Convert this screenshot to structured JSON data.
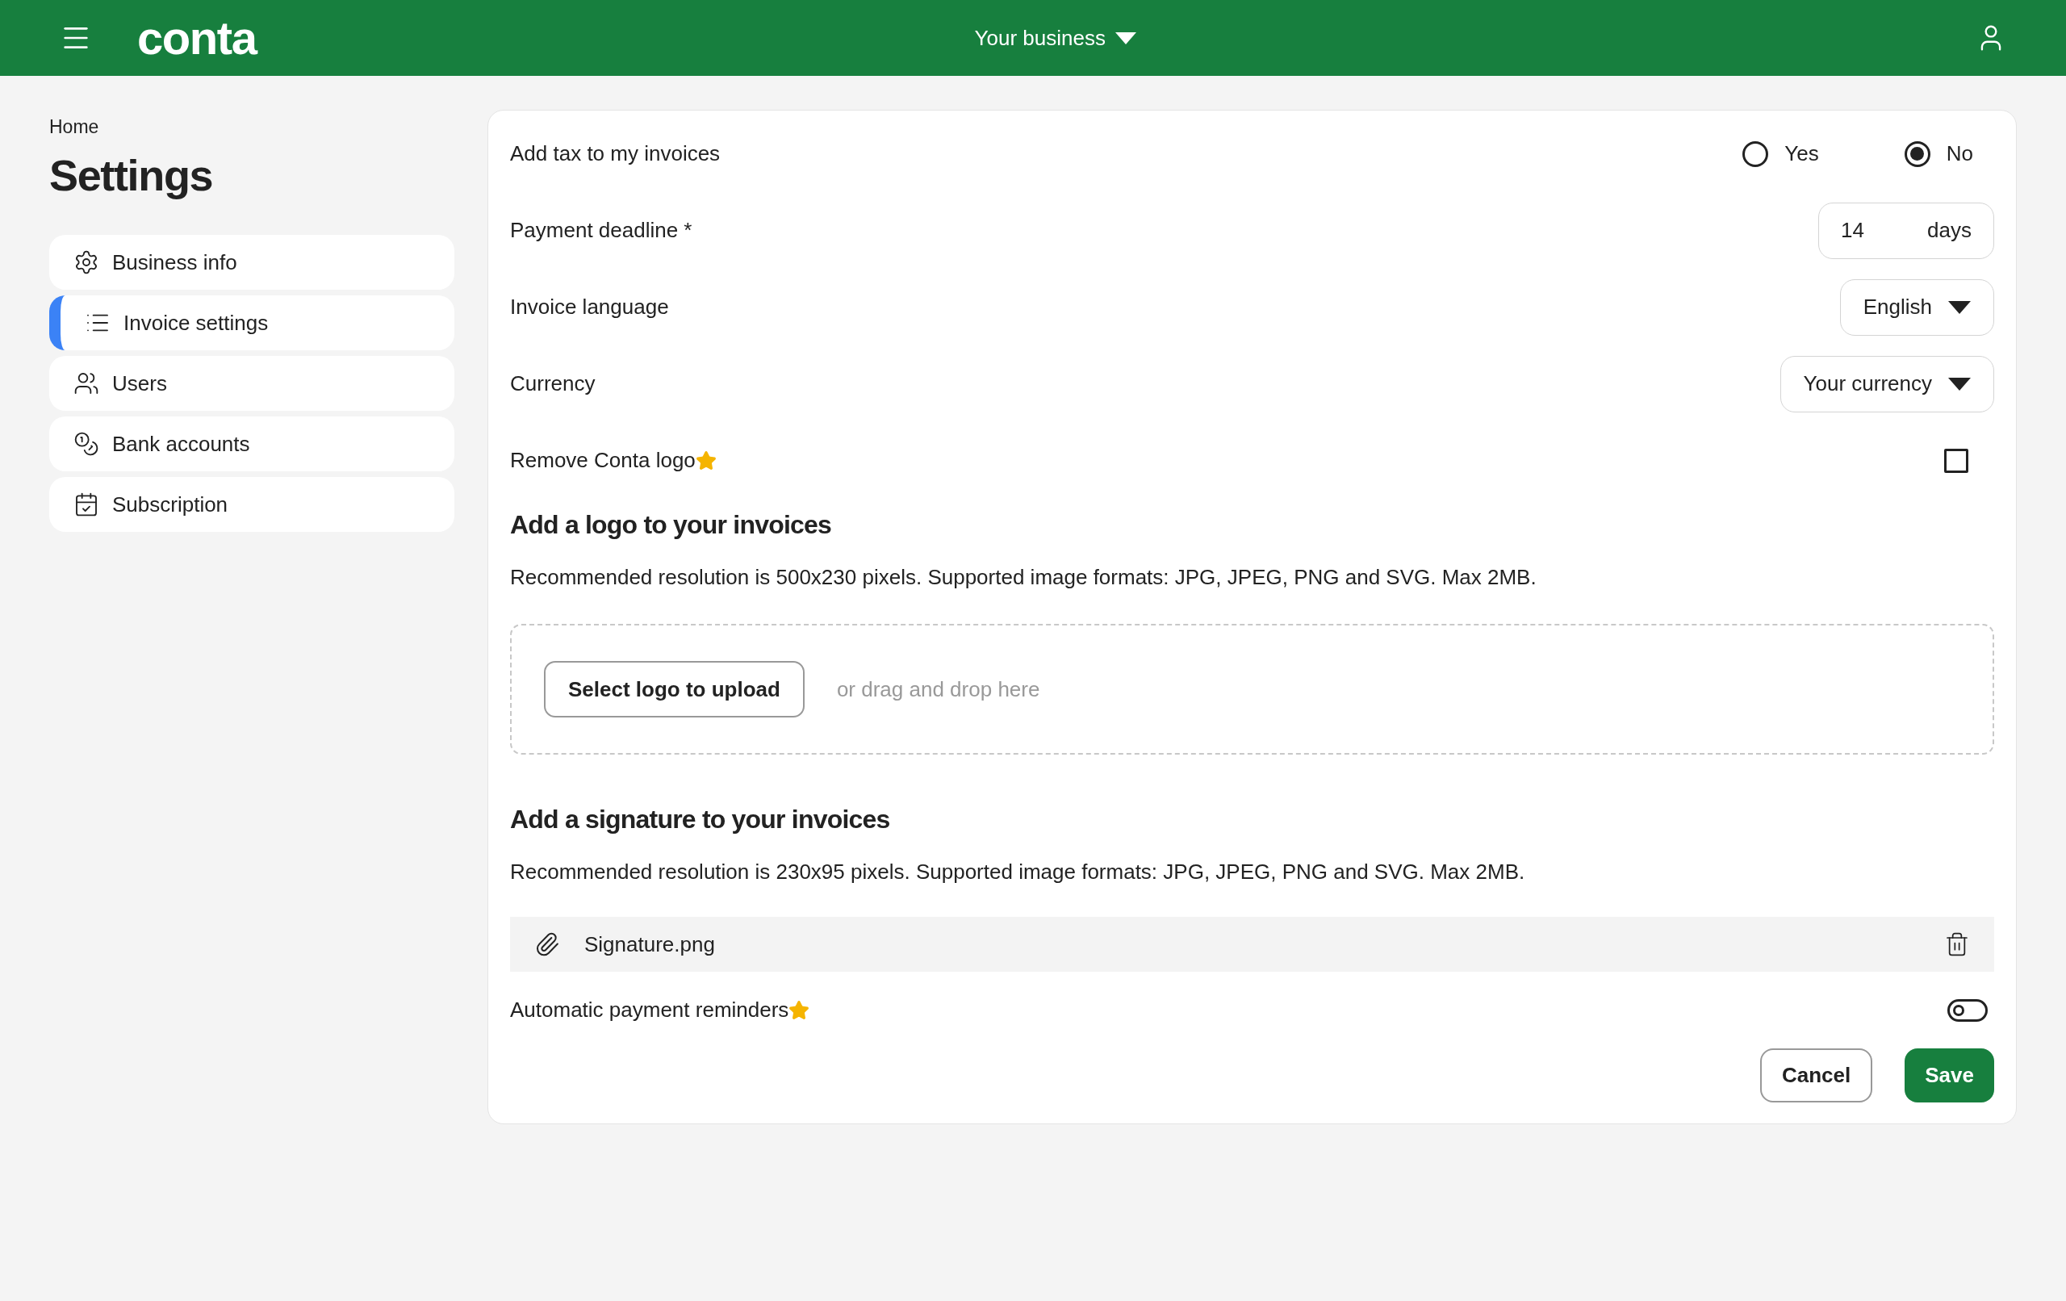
{
  "header": {
    "logo": "conta",
    "business_menu": "Your business"
  },
  "breadcrumb": "Home",
  "title": "Settings",
  "sidebar": {
    "items": [
      {
        "label": "Business info",
        "selected": false
      },
      {
        "label": "Invoice settings",
        "selected": true
      },
      {
        "label": "Users",
        "selected": false
      },
      {
        "label": "Bank accounts",
        "selected": false
      },
      {
        "label": "Subscription",
        "selected": false
      }
    ]
  },
  "form": {
    "tax": {
      "label": "Add tax to my invoices",
      "options": [
        {
          "label": "Yes",
          "selected": false
        },
        {
          "label": "No",
          "selected": true
        }
      ]
    },
    "payment_deadline": {
      "label": "Payment deadline *",
      "value": "14",
      "unit": "days"
    },
    "language": {
      "label": "Invoice language",
      "value": "English"
    },
    "currency": {
      "label": "Currency",
      "value": "Your currency"
    },
    "remove_logo": {
      "label": "Remove Conta logo",
      "checked": false
    },
    "logo_section": {
      "heading": "Add a logo to your invoices",
      "description": "Recommended resolution is 500x230 pixels. Supported image formats: JPG, JPEG, PNG and SVG. Max 2MB.",
      "upload_button": "Select logo to upload",
      "drop_hint": "or drag and drop here"
    },
    "signature_section": {
      "heading": "Add a signature to your invoices",
      "description": "Recommended resolution is 230x95 pixels. Supported image formats: JPG, JPEG, PNG and SVG. Max 2MB.",
      "file": "Signature.png"
    },
    "reminders": {
      "label": "Automatic payment reminders",
      "on": false
    },
    "buttons": {
      "cancel": "Cancel",
      "save": "Save"
    }
  }
}
